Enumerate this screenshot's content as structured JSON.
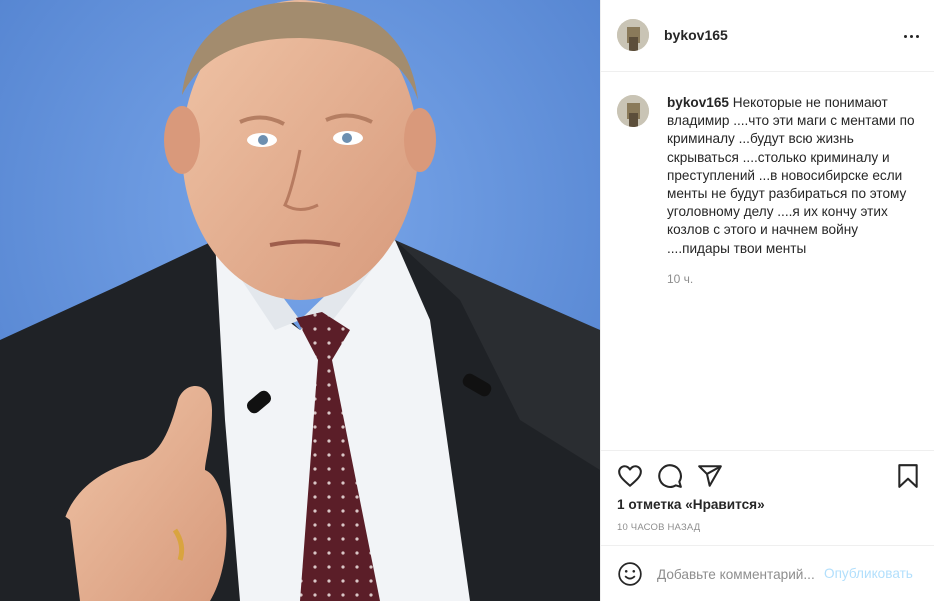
{
  "post": {
    "username": "bykov165",
    "more_icon": "more-horizontal-icon",
    "caption": {
      "username": "bykov165",
      "text": "Некоторые не понимают владимир ....что эти маги с ментами по криминалу ...будут всю жизнь скрываться ....столько криминалу и преступлений ...в новосибирске если менты не будут разбираться по этому уголовному делу ....я их кончу этих козлов с этого и начнем войну ....пидары твои менты"
    },
    "caption_time": "10 ч.",
    "actions": {
      "like_icon": "heart-icon",
      "comment_icon": "comment-icon",
      "share_icon": "paper-plane-icon",
      "save_icon": "bookmark-icon"
    },
    "likes_text": "1 отметка «Нравится»",
    "posted_ago": "10 часов назад",
    "comment": {
      "emoji_icon": "smiley-icon",
      "placeholder": "Добавьте комментарий...",
      "publish_label": "Опубликовать"
    }
  },
  "colors": {
    "text": "#262626",
    "secondary": "#8e8e8e",
    "publish_disabled": "#b2dffc",
    "divider": "#efefef"
  }
}
